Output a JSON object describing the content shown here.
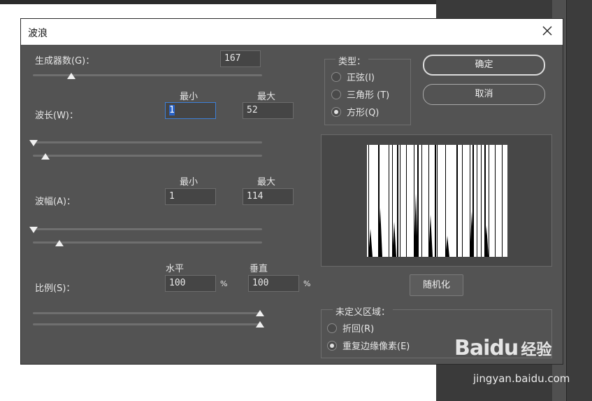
{
  "dialog": {
    "title": "波浪",
    "generators": {
      "label": "生成器数(G)：",
      "value": "167",
      "slider_fraction": 0.17
    },
    "wavelength": {
      "label": "波长(W)：",
      "min_header": "最小",
      "max_header": "最大",
      "min_value": "1",
      "max_value": "52",
      "min_slider_fraction": 0.0,
      "max_slider_fraction": 0.05
    },
    "amplitude": {
      "label": "波幅(A)：",
      "min_header": "最小",
      "max_header": "最大",
      "min_value": "1",
      "max_value": "114",
      "min_slider_fraction": 0.0,
      "max_slider_fraction": 0.11
    },
    "scale": {
      "label": "比例(S)：",
      "horizontal_header": "水平",
      "vertical_header": "垂直",
      "horizontal_value": "100",
      "vertical_value": "100",
      "unit": "%",
      "horizontal_slider_fraction": 1.0,
      "vertical_slider_fraction": 1.0
    },
    "type_group": {
      "legend": "类型：",
      "options": [
        {
          "label": "正弦(I)",
          "selected": false
        },
        {
          "label": "三角形 (T)",
          "selected": false
        },
        {
          "label": "方形(Q)",
          "selected": true
        }
      ]
    },
    "buttons": {
      "ok": "确定",
      "cancel": "取消",
      "randomize": "随机化"
    },
    "undefined_area": {
      "legend": "未定义区域：",
      "options": [
        {
          "label": "折回(R)",
          "selected": false
        },
        {
          "label": "重复边缘像素(E)",
          "selected": true
        }
      ]
    }
  },
  "watermark": {
    "brand": "Baidu",
    "product": "经验",
    "url": "jingyan.baidu.com"
  },
  "colors": {
    "dialog_bg": "#535353",
    "field_bg": "#454545",
    "focus": "#3d7fd6"
  }
}
